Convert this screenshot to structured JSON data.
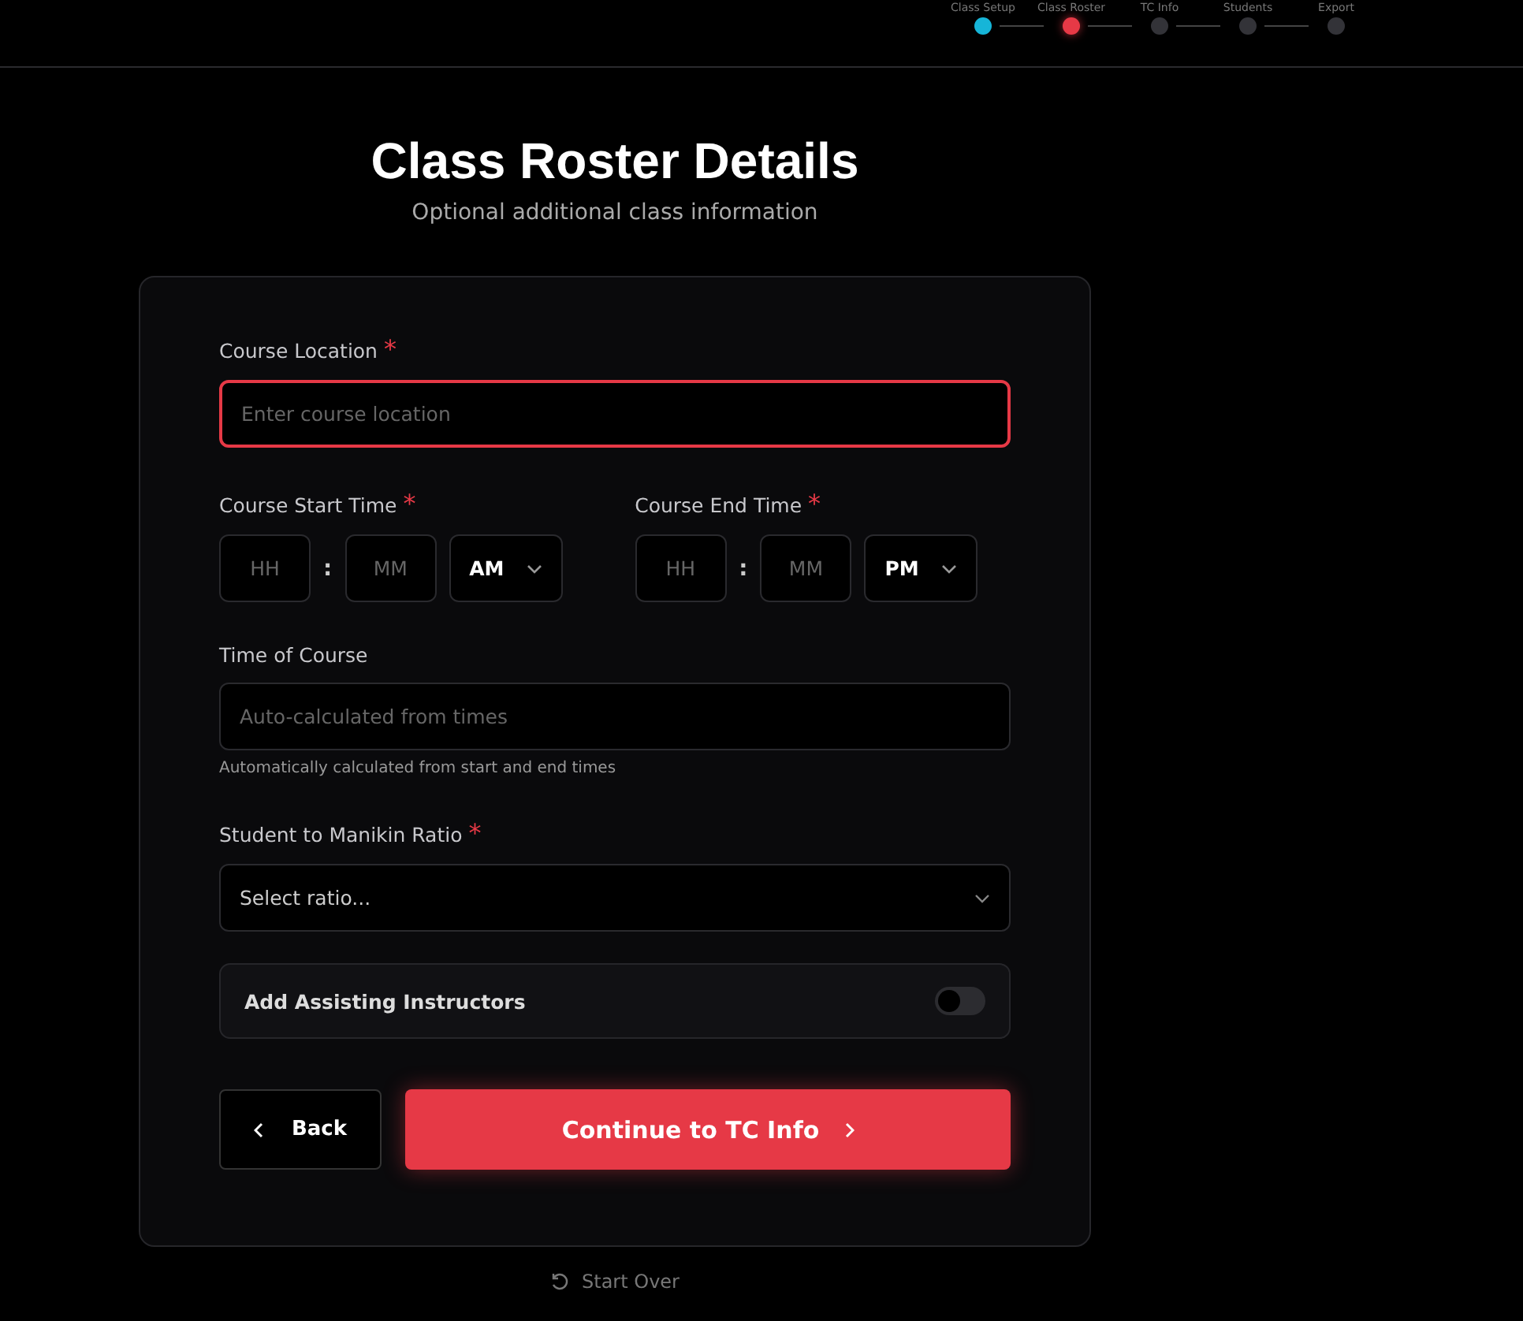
{
  "stepper": [
    {
      "label": "Class Setup",
      "completed": true,
      "selected": false
    },
    {
      "label": "Class Roster",
      "completed": false,
      "selected": true
    },
    {
      "label": "TC Info",
      "completed": false,
      "selected": false
    },
    {
      "label": "Students",
      "completed": false,
      "selected": false
    },
    {
      "label": "Export",
      "completed": false,
      "selected": false
    }
  ],
  "title": "Class Roster Details",
  "subtitle": "Optional additional class information",
  "course_location": {
    "label": "Course Location",
    "required_mark": "*",
    "placeholder": "Enter course location",
    "focused": true
  },
  "times": [
    {
      "label": "Course Start Time",
      "required_mark": "*",
      "hour_placeholder": "HH",
      "separator": ":",
      "minute_placeholder": "MM",
      "period": "AM"
    },
    {
      "label": "Course End Time",
      "required_mark": "*",
      "hour_placeholder": "HH",
      "separator": ":",
      "minute_placeholder": "MM",
      "period": "PM"
    }
  ],
  "time_of_course": {
    "label": "Time of Course",
    "placeholder": "Auto-calculated from times",
    "hint": "Automatically calculated from start and end times"
  },
  "ratio": {
    "label": "Student to Manikin Ratio",
    "required_mark": "*",
    "placeholder": "Select ratio..."
  },
  "assisting_instructors": {
    "label": "Add Assisting Instructors",
    "on": false
  },
  "back_button": "Back",
  "continue_button": "Continue to TC Info",
  "start_over": "Start Over"
}
